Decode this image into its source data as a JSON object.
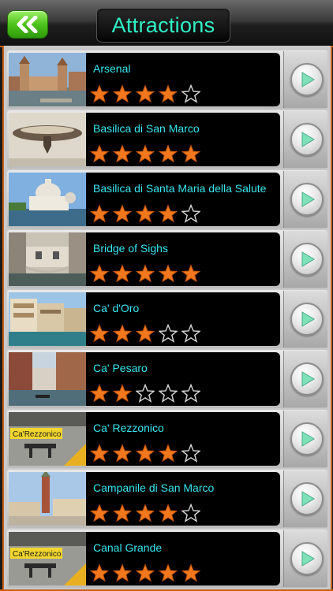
{
  "header": {
    "title": "Attractions",
    "back_icon": "double-chevron-left-icon"
  },
  "colors": {
    "accent": "#c4611d",
    "title_text": "#2ef0c6",
    "item_text": "#36e6ee",
    "star_fill": "#f2781e",
    "back_button": "#4cc21a",
    "go_arrow": "#7fe1b8"
  },
  "items": [
    {
      "name": "Arsenal",
      "rating": 4,
      "rating_max": 5
    },
    {
      "name": "Basilica di San Marco",
      "rating": 5,
      "rating_max": 5
    },
    {
      "name": "Basilica di Santa Maria della Salute",
      "rating": 4,
      "rating_max": 5
    },
    {
      "name": "Bridge of Sighs",
      "rating": 5,
      "rating_max": 5
    },
    {
      "name": "Ca' d'Oro",
      "rating": 3,
      "rating_max": 5
    },
    {
      "name": "Ca' Pesaro",
      "rating": 2,
      "rating_max": 5
    },
    {
      "name": "Ca' Rezzonico",
      "rating": 4,
      "rating_max": 5,
      "thumb_sign": "Ca'Rezzonico"
    },
    {
      "name": "Campanile di San Marco",
      "rating": 4,
      "rating_max": 5
    },
    {
      "name": "Canal Grande",
      "rating": 5,
      "rating_max": 5,
      "thumb_sign": "Ca'Rezzonico"
    }
  ]
}
